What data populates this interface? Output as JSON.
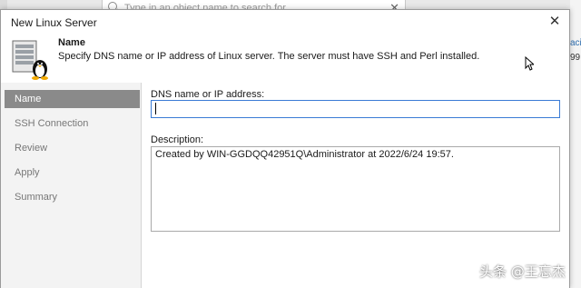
{
  "background": {
    "search_placeholder": "Type in an object name to search for",
    "right_text_1": "aci",
    "right_text_2": "99"
  },
  "dialog": {
    "title": "New Linux Server",
    "header": {
      "title": "Name",
      "description": "Specify DNS name or IP address of Linux server. The server must have SSH and Perl installed."
    },
    "steps": [
      {
        "label": "Name",
        "active": true
      },
      {
        "label": "SSH Connection",
        "active": false
      },
      {
        "label": "Review",
        "active": false
      },
      {
        "label": "Apply",
        "active": false
      },
      {
        "label": "Summary",
        "active": false
      }
    ],
    "dns_label": "DNS name or IP address:",
    "dns_value": "",
    "description_label": "Description:",
    "description_value": "Created by WIN-GGDQQ42951Q\\Administrator at 2022/6/24 19:57."
  },
  "watermark": "头条 @王忘杰",
  "colors": {
    "active_step_bg": "#8a8a8a",
    "input_focus_border": "#3a7bd5"
  }
}
